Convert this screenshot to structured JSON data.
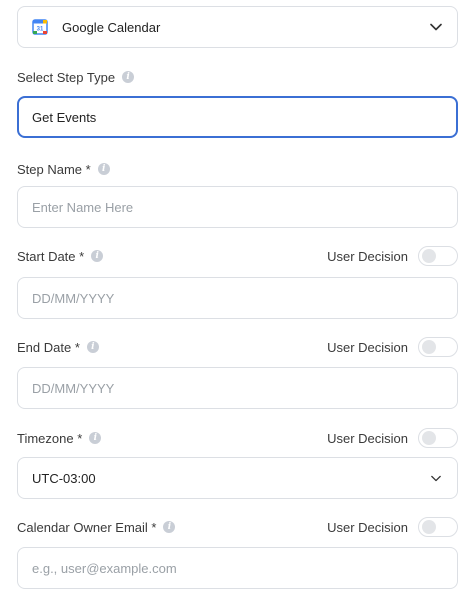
{
  "integration": {
    "value": "Google Calendar",
    "icon": "google-calendar-icon"
  },
  "step_type": {
    "label": "Select Step Type",
    "value": "Get Events"
  },
  "step_name": {
    "label": "Step Name *",
    "placeholder": "Enter Name Here"
  },
  "start_date": {
    "label": "Start Date *",
    "placeholder": "DD/MM/YYYY",
    "user_decision": "User Decision",
    "user_decision_on": false
  },
  "end_date": {
    "label": "End Date *",
    "placeholder": "DD/MM/YYYY",
    "user_decision": "User Decision",
    "user_decision_on": false
  },
  "timezone": {
    "label": "Timezone *",
    "value": "UTC-03:00",
    "user_decision": "User Decision",
    "user_decision_on": false
  },
  "owner_email": {
    "label": "Calendar Owner Email *",
    "placeholder": "e.g., user@example.com",
    "user_decision": "User Decision",
    "user_decision_on": false
  },
  "colors": {
    "accent": "#3b6fd4",
    "border": "#dcdfe4",
    "placeholder": "#9aa0a6"
  }
}
